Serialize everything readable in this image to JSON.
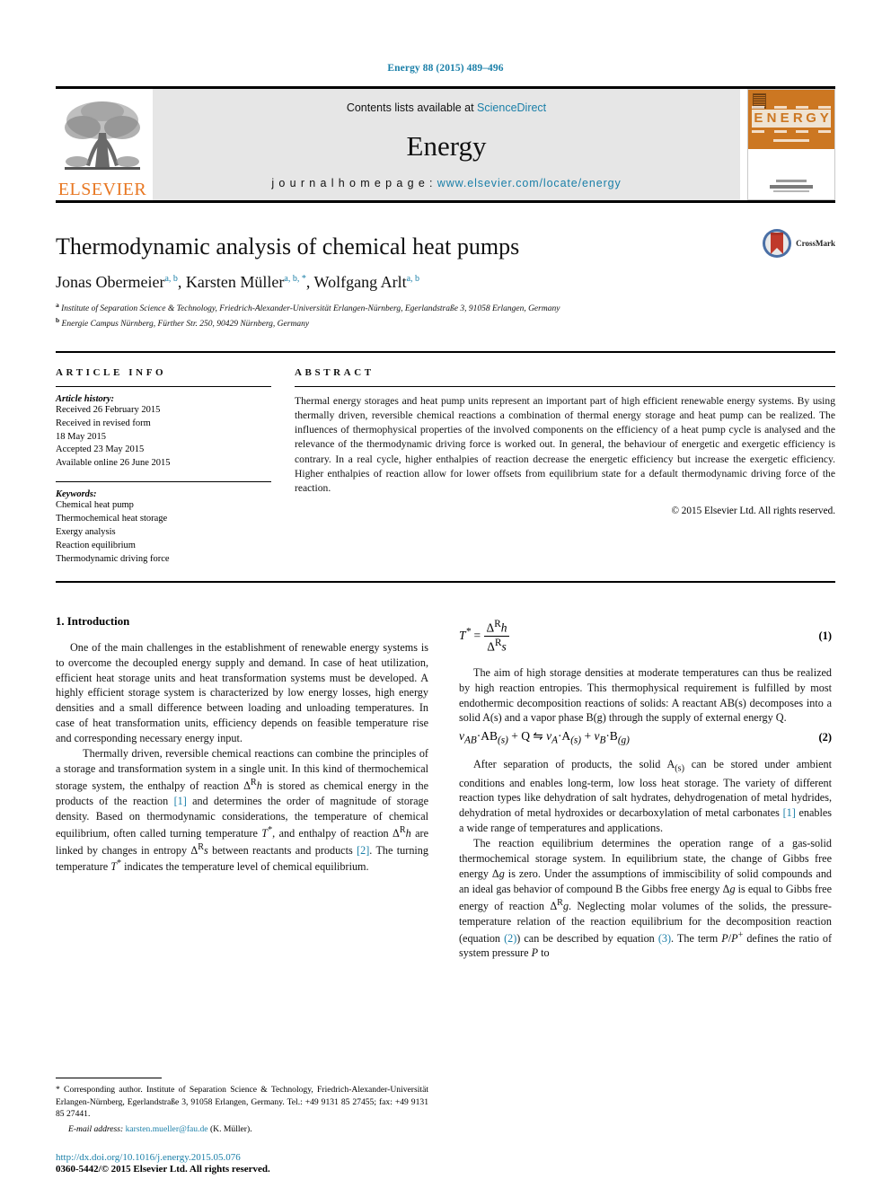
{
  "running_head": "Energy 88 (2015) 489–496",
  "masthead": {
    "publisher_name": "ELSEVIER",
    "contents_prefix": "Contents lists available at ",
    "contents_link": "ScienceDirect",
    "journal_name": "Energy",
    "homepage_prefix": "j o u r n a l   h o m e p a g e :  ",
    "homepage_url": "www.elsevier.com/locate/energy",
    "cover_word": "ENERGY",
    "colors": {
      "link": "#1a7fa8",
      "elsevier_orange": "#E87722",
      "cover_orange": "#cc7722",
      "panel_gray": "#e6e6e6"
    }
  },
  "article": {
    "title": "Thermodynamic analysis of chemical heat pumps",
    "authors_html": "Jonas Obermeier, Karsten Müller, Wolfgang Arlt",
    "author_list": [
      {
        "name": "Jonas Obermeier",
        "marks": "a, b"
      },
      {
        "name": "Karsten Müller",
        "marks": "a, b, *"
      },
      {
        "name": "Wolfgang Arlt",
        "marks": "a, b"
      }
    ],
    "affiliations": [
      {
        "mark": "a",
        "text": "Institute of Separation Science & Technology, Friedrich-Alexander-Universität Erlangen-Nürnberg, Egerlandstraße 3, 91058 Erlangen, Germany"
      },
      {
        "mark": "b",
        "text": "Energie Campus Nürnberg, Fürther Str. 250, 90429 Nürnberg, Germany"
      }
    ],
    "crossmark_label": "CrossMark"
  },
  "article_info": {
    "heading": "ARTICLE INFO",
    "history_label": "Article history:",
    "history": [
      "Received 26 February 2015",
      "Received in revised form",
      "18 May 2015",
      "Accepted 23 May 2015",
      "Available online 26 June 2015"
    ],
    "keywords_label": "Keywords:",
    "keywords": [
      "Chemical heat pump",
      "Thermochemical heat storage",
      "Exergy analysis",
      "Reaction equilibrium",
      "Thermodynamic driving force"
    ]
  },
  "abstract": {
    "heading": "ABSTRACT",
    "text": "Thermal energy storages and heat pump units represent an important part of high efficient renewable energy systems. By using thermally driven, reversible chemical reactions a combination of thermal energy storage and heat pump can be realized. The influences of thermophysical properties of the involved components on the efficiency of a heat pump cycle is analysed and the relevance of the thermodynamic driving force is worked out. In general, the behaviour of energetic and exergetic efficiency is contrary. In a real cycle, higher enthalpies of reaction decrease the energetic efficiency but increase the exergetic efficiency. Higher enthalpies of reaction allow for lower offsets from equilibrium state for a default thermodynamic driving force of the reaction.",
    "copyright": "© 2015 Elsevier Ltd. All rights reserved."
  },
  "body": {
    "section1_heading": "1. Introduction",
    "left_paragraphs": [
      "One of the main challenges in the establishment of renewable energy systems is to overcome the decoupled energy supply and demand. In case of heat utilization, efficient heat storage units and heat transformation systems must be developed. A highly efficient storage system is characterized by low energy losses, high energy densities and a small difference between loading and unloading temperatures. In case of heat transformation units, efficiency depends on feasible temperature rise and corresponding necessary energy input.",
      "Thermally driven, reversible chemical reactions can combine the principles of a storage and transformation system in a single unit. In this kind of thermochemical storage system, the enthalpy of reaction ΔRh is stored as chemical energy in the products of the reaction [1] and determines the order of magnitude of storage density. Based on thermodynamic considerations, the temperature of chemical equilibrium, often called turning temperature T*, and enthalpy of reaction ΔRh are linked by changes in entropy ΔRs between reactants and products [2]. The turning temperature T* indicates the temperature level of chemical equilibrium."
    ],
    "equations": [
      {
        "number": "(1)",
        "lhs": "T*",
        "rel": "=",
        "num": "Δ^R h",
        "den": "Δ^R s"
      },
      {
        "number": "(2)",
        "text": "νAB·AB(s) + Q ⇌ νA·A(s) + νB·B(g)"
      }
    ],
    "right_paragraphs": [
      "The aim of high storage densities at moderate temperatures can thus be realized by high reaction entropies. This thermophysical requirement is fulfilled by most endothermic decomposition reactions of solids: A reactant AB(s) decomposes into a solid A(s) and a vapor phase B(g) through the supply of external energy Q.",
      "After separation of products, the solid A(s) can be stored under ambient conditions and enables long-term, low loss heat storage. The variety of different reaction types like dehydration of salt hydrates, dehydrogenation of metal hydrides, dehydration of metal hydroxides or decarboxylation of metal carbonates [1] enables a wide range of temperatures and applications.",
      "The reaction equilibrium determines the operation range of a gas-solid thermochemical storage system. In equilibrium state, the change of Gibbs free energy Δg is zero. Under the assumptions of immiscibility of solid compounds and an ideal gas behavior of compound B the Gibbs free energy Δg is equal to Gibbs free energy of reaction ΔRg. Neglecting molar volumes of the solids, the pressure-temperature relation of the reaction equilibrium for the decomposition reaction (equation (2)) can be described by equation (3). The term P/P+ defines the ratio of system pressure P to"
    ]
  },
  "footnote": {
    "corresponding": "* Corresponding author. Institute of Separation Science & Technology, Friedrich-Alexander-Universität Erlangen-Nürnberg, Egerlandstraße 3, 91058 Erlangen, Germany. Tel.: +49 9131 85 27455; fax: +49 9131 85 27441.",
    "email_label": "E-mail address:",
    "email": "karsten.mueller@fau.de",
    "email_owner": "(K. Müller).",
    "doi": "http://dx.doi.org/10.1016/j.energy.2015.05.076",
    "issn_line": "0360-5442/© 2015 Elsevier Ltd. All rights reserved."
  }
}
